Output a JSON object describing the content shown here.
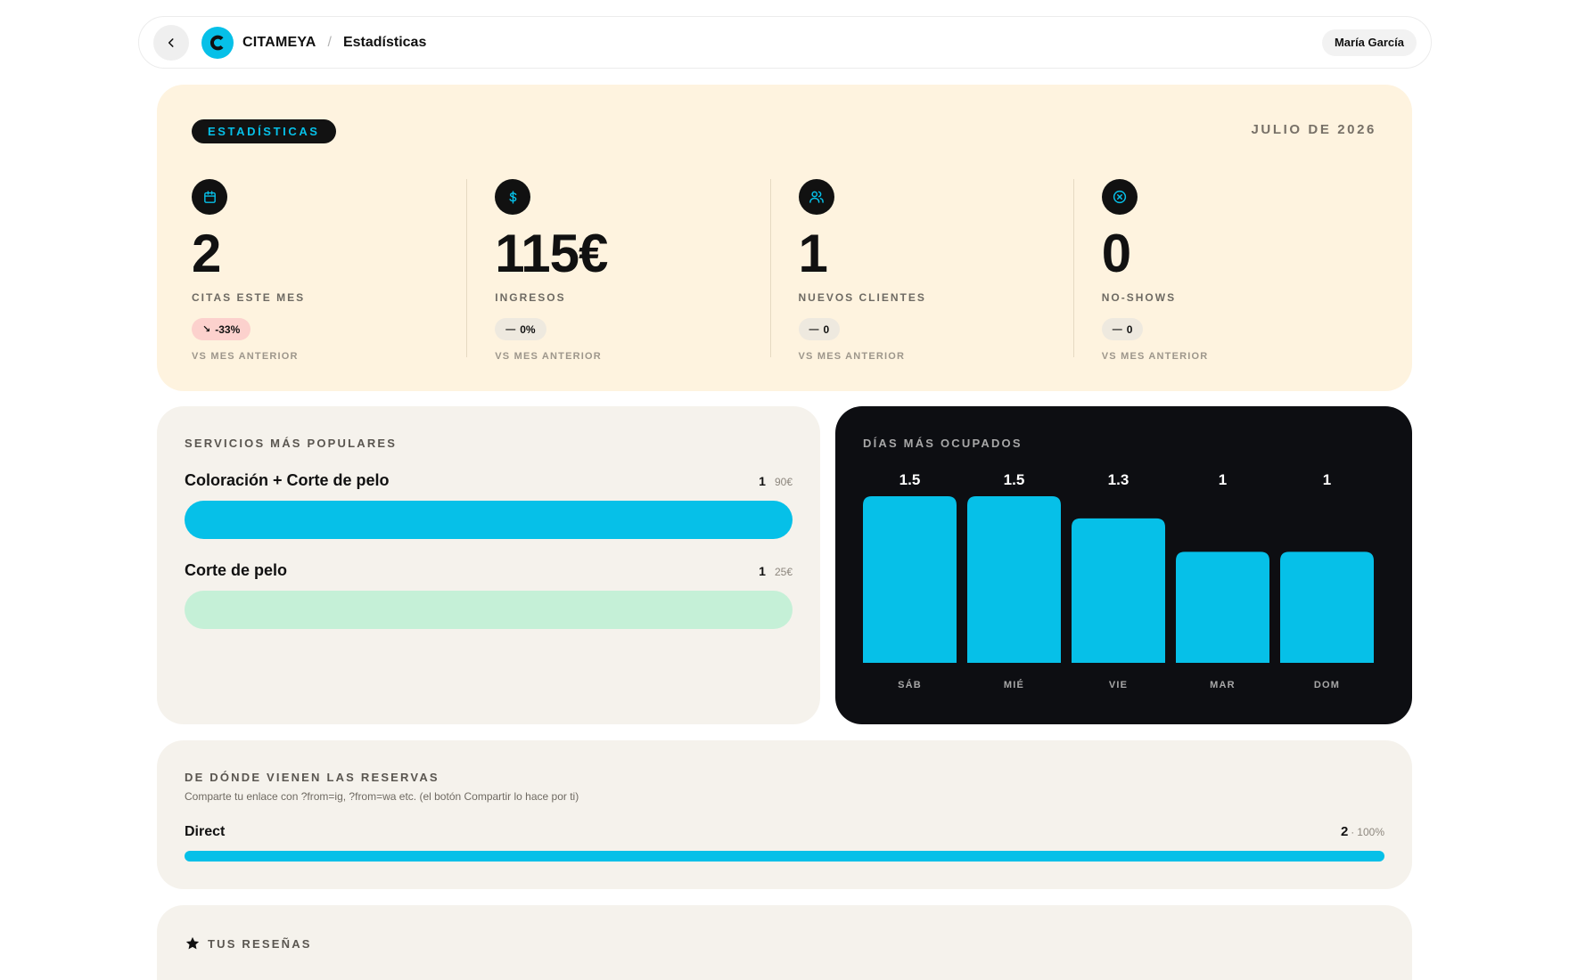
{
  "header": {
    "brand": "CITAMEYA",
    "brand_initial": "C",
    "separator": "/",
    "current_page": "Estadísticas",
    "user_name": "María García"
  },
  "summary": {
    "tag": "ESTADÍSTICAS",
    "month": "JULIO DE 2026",
    "stats": [
      {
        "icon": "calendar-icon",
        "value": "2",
        "label": "CITAS ESTE MES",
        "delta_arrow": "↘",
        "delta": "-33%",
        "trend": "down",
        "vs": "VS MES ANTERIOR"
      },
      {
        "icon": "dollar-icon",
        "value": "115€",
        "label": "INGRESOS",
        "delta_arrow": "—",
        "delta": "0%",
        "trend": "flat",
        "vs": "VS MES ANTERIOR"
      },
      {
        "icon": "users-icon",
        "value": "1",
        "label": "NUEVOS CLIENTES",
        "delta_arrow": "—",
        "delta": "0",
        "trend": "flat",
        "vs": "VS MES ANTERIOR"
      },
      {
        "icon": "x-circle-icon",
        "value": "0",
        "label": "NO-SHOWS",
        "delta_arrow": "—",
        "delta": "0",
        "trend": "flat",
        "vs": "VS MES ANTERIOR"
      }
    ]
  },
  "services": {
    "title": "SERVICIOS MÁS POPULARES",
    "items": [
      {
        "name": "Coloración + Corte de pelo",
        "count": "1",
        "price": "90€",
        "fraction": 1.0,
        "color": "#06c0e8"
      },
      {
        "name": "Corte de pelo",
        "count": "1",
        "price": "25€",
        "fraction": 1.0,
        "color": "#c5f0d7"
      }
    ]
  },
  "busy_days": {
    "title": "DÍAS MÁS OCUPADOS"
  },
  "chart_data": {
    "type": "bar",
    "categories": [
      "SÁB",
      "MIÉ",
      "VIE",
      "MAR",
      "DOM"
    ],
    "values": [
      1.5,
      1.5,
      1.3,
      1,
      1
    ],
    "value_labels": [
      "1.5",
      "1.5",
      "1.3",
      "1",
      "1"
    ],
    "ylim": [
      0,
      1.5
    ],
    "grid": false,
    "bar_color": "#06c0e8",
    "label_color": "#ffffff",
    "tick_color": "#a7a7a7"
  },
  "sources": {
    "title": "DE DÓNDE VIENEN LAS RESERVAS",
    "subtitle": "Comparte tu enlace con ?from=ig, ?from=wa etc. (el botón Compartir lo hace por ti)",
    "items": [
      {
        "name": "Direct",
        "count": "2",
        "separator": "·",
        "percent": "100%",
        "fraction": 1.0
      }
    ]
  },
  "reviews": {
    "title": "TUS RESEÑAS",
    "icon": "star-icon"
  },
  "colors": {
    "accent": "#06c0e8",
    "summary_bg": "#fef3df",
    "card_bg": "#f5f2ec",
    "dark_card": "#0d0e12",
    "delta_down": "#fcd1cd"
  }
}
